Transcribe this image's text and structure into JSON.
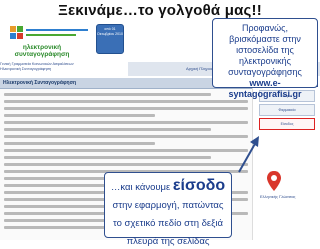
{
  "slide": {
    "title": "Ξεκινάμε…το γολγοθά μας!!"
  },
  "site": {
    "logo_caption": "ηλεκτρονική συνταγογράφηση",
    "deadline_label": "από 01 Οκτωβρίου 2010",
    "gov_line1": "Γενική Γραμματεία Κοινωνικών Ασφαλίσεων",
    "gov_line2": "Ηλεκτρονική Συνταγογράφηση",
    "nav_items": "Αρχική   Πληροφορίες   Αρμόδιοι   Επικοινωνία",
    "content_header": "Ηλεκτρονική Συνταγογράφηση",
    "sidebar_header": "Είσοδος",
    "sidebar_items": [
      "Ιατροί",
      "Φαρμακεία",
      "Είσοδος"
    ],
    "sidebar_caption": "Ελληνικής Γλώσσας"
  },
  "callouts": {
    "top_text": "Προφανώς, βρισκόμαστε στην ιστοσελίδα της ηλεκτρονικής συνταγογράφησης",
    "top_url": "www.e-syntagografisi.gr",
    "bottom_prefix": "…και κάνουμε ",
    "bottom_bold": "είσοδο",
    "bottom_suffix": " στην εφαρμογή, πατώντας το σχετικό πεδίο στη δεξιά πλευρά της σελίδας"
  },
  "colors": {
    "accent": "#2f4f8f",
    "callout_text": "#1b3d8c",
    "highlight": "#dd2222"
  }
}
